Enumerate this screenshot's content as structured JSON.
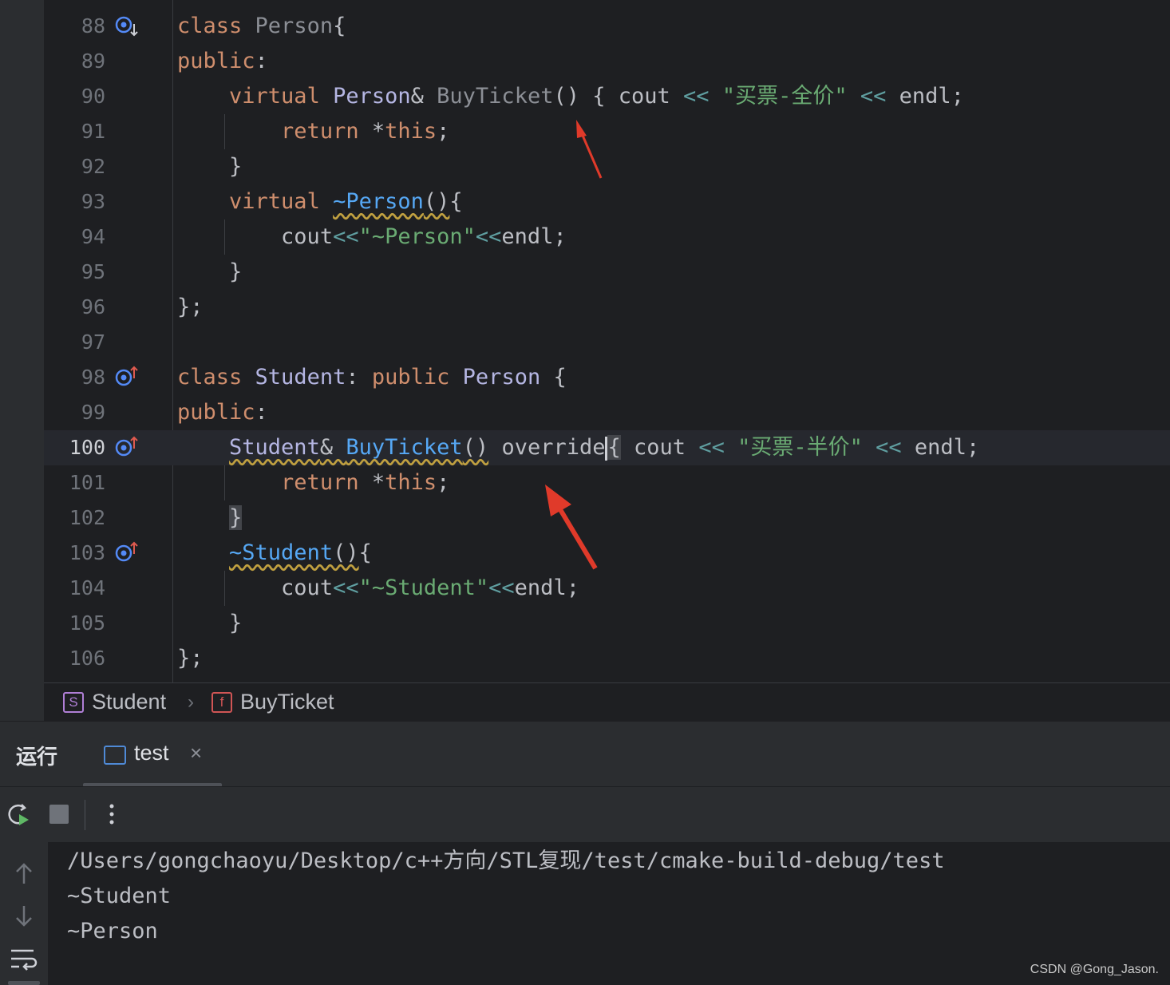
{
  "editor": {
    "lines": {
      "l88": "88",
      "l89": "89",
      "l90": "90",
      "l91": "91",
      "l92": "92",
      "l93": "93",
      "l94": "94",
      "l95": "95",
      "l96": "96",
      "l97": "97",
      "l98": "98",
      "l99": "99",
      "l100": "100",
      "l101": "101",
      "l102": "102",
      "l103": "103",
      "l104": "104",
      "l105": "105",
      "l106": "106"
    },
    "current_line": "100",
    "code": {
      "class": "class",
      "public": "public",
      "virtual": "virtual",
      "return": "return",
      "this": "this",
      "override": "override",
      "cout": "cout",
      "endl": "endl",
      "person": "Person",
      "student": "Student",
      "buyticket": "BuyTicket",
      "dtor_person": "~Person",
      "dtor_student": "~Student",
      "str_full": "\"买票-全价\"",
      "str_half": "\"买票-半价\"",
      "str_dtor_person": "\"~Person\"",
      "str_dtor_student": "\"~Student\""
    }
  },
  "breadcrumb": {
    "class_icon": "S",
    "class_name": "Student",
    "func_icon": "f",
    "func_name": "BuyTicket"
  },
  "run_panel": {
    "title": "运行",
    "tab_label": "test",
    "tab_close": "×",
    "icons": [
      "rerun-icon",
      "stop-icon",
      "more-options-icon",
      "scroll-up-icon",
      "scroll-down-icon",
      "soft-wrap-icon"
    ]
  },
  "console": {
    "output": [
      "/Users/gongchaoyu/Desktop/c++方向/STL复现/test/cmake-build-debug/test",
      "~Student",
      "~Person"
    ]
  },
  "watermark": "CSDN @Gong_Jason."
}
